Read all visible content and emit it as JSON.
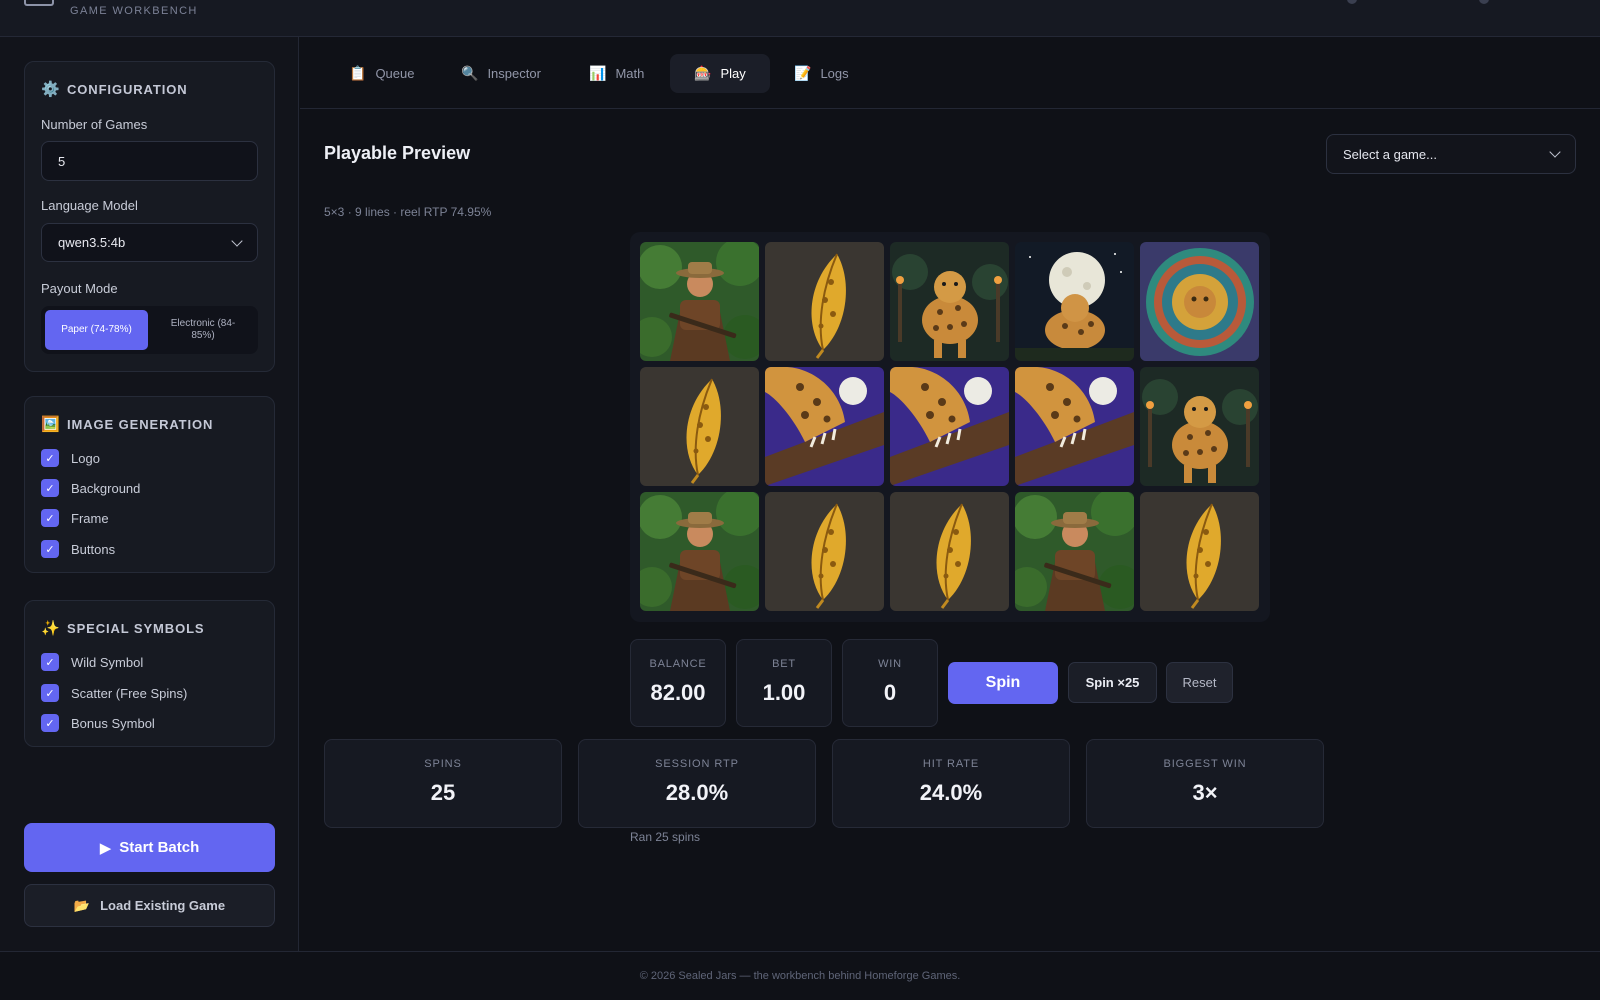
{
  "app": {
    "subtitle": "GAME WORKBENCH"
  },
  "sidebar": {
    "configuration": {
      "icon": "gear-icon",
      "icon_glyph": "⚙️",
      "title": "CONFIGURATION",
      "num_games_label": "Number of Games",
      "num_games_value": "5",
      "model_label": "Language Model",
      "model_value": "qwen3.5:4b",
      "payout_label": "Payout Mode",
      "payout_options": [
        {
          "label": "Paper (74-78%)",
          "selected": true
        },
        {
          "label": "Electronic (84-85%)",
          "selected": false
        }
      ]
    },
    "image_generation": {
      "icon": "picture-icon",
      "icon_glyph": "🖼️",
      "title": "IMAGE GENERATION",
      "items": [
        {
          "label": "Logo",
          "checked": true
        },
        {
          "label": "Background",
          "checked": true
        },
        {
          "label": "Frame",
          "checked": true
        },
        {
          "label": "Buttons",
          "checked": true
        }
      ]
    },
    "special_symbols": {
      "icon": "sparkles-icon",
      "icon_glyph": "✨",
      "title": "SPECIAL SYMBOLS",
      "items": [
        {
          "label": "Wild Symbol",
          "checked": true
        },
        {
          "label": "Scatter (Free Spins)",
          "checked": true
        },
        {
          "label": "Bonus Symbol",
          "checked": true
        }
      ]
    },
    "start_batch_label": "Start Batch",
    "start_batch_icon": "▶",
    "load_game_label": "Load Existing Game",
    "load_game_icon": "📂",
    "check_glyph": "✓"
  },
  "tabs": [
    {
      "label": "Queue",
      "icon": "clipboard-icon",
      "glyph": "📋",
      "active": false
    },
    {
      "label": "Inspector",
      "icon": "magnifier-icon",
      "glyph": "🔍",
      "active": false
    },
    {
      "label": "Math",
      "icon": "bar-chart-icon",
      "glyph": "📊",
      "active": false
    },
    {
      "label": "Play",
      "icon": "slot-machine-icon",
      "glyph": "🎰",
      "active": true
    },
    {
      "label": "Logs",
      "icon": "memo-icon",
      "glyph": "📝",
      "active": false
    }
  ],
  "play": {
    "title": "Playable Preview",
    "game_select_placeholder": "Select a game...",
    "meta": "5×3 · 9 lines · reel RTP 74.95%",
    "grid": [
      [
        "explorer",
        "feather",
        "jaguar",
        "moon-jaguar",
        "aztec-disc"
      ],
      [
        "feather",
        "paw",
        "paw",
        "paw",
        "jaguar"
      ],
      [
        "explorer",
        "feather",
        "feather",
        "explorer",
        "feather"
      ]
    ],
    "balance_label": "BALANCE",
    "balance_value": "82.00",
    "bet_label": "BET",
    "bet_value": "1.00",
    "win_label": "WIN",
    "win_value": "0",
    "spin_label": "Spin",
    "spin25_label": "Spin ×25",
    "reset_label": "Reset",
    "session_stats": [
      {
        "label": "SPINS",
        "value": "25"
      },
      {
        "label": "SESSION RTP",
        "value": "28.0%"
      },
      {
        "label": "HIT RATE",
        "value": "24.0%"
      },
      {
        "label": "BIGGEST WIN",
        "value": "3×"
      }
    ],
    "note": "Ran 25 spins"
  },
  "footer": {
    "text": "© 2026 Sealed Jars — the workbench behind Homeforge Games."
  },
  "colors": {
    "accent": "#6366f1",
    "background": "#0f1117",
    "panel": "#171a22"
  }
}
